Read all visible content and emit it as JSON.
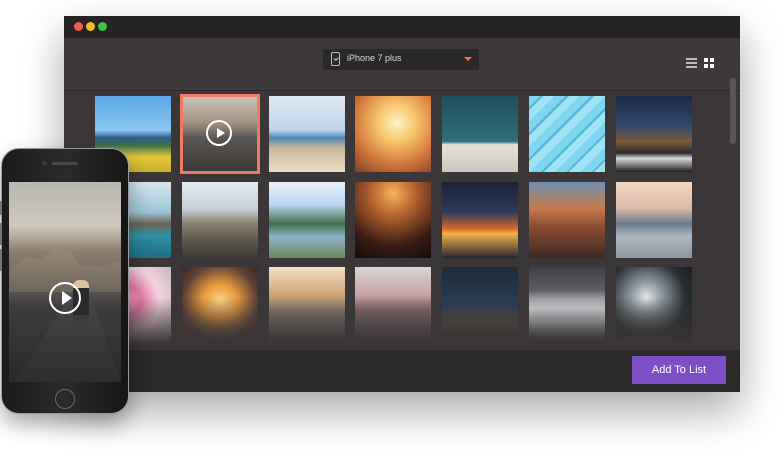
{
  "window": {
    "device_select": {
      "value": "iPhone 7 plus",
      "icon": "iphone-check-icon",
      "caret_color": "#f07a30"
    },
    "view_toggle": {
      "list_icon": "list-view-icon",
      "grid_icon": "grid-view-icon"
    },
    "add_button_label": "Add To List",
    "accent_color": "#7d4fc7",
    "selected_outline_color": "#f07a64"
  },
  "thumbnails": [
    {
      "subject": "coast-landscape",
      "selected": false,
      "video": false
    },
    {
      "subject": "skateboarder-road",
      "selected": true,
      "video": true
    },
    {
      "subject": "beach-skateboard",
      "selected": false,
      "video": false
    },
    {
      "subject": "sunset-runners",
      "selected": false,
      "video": false
    },
    {
      "subject": "bird-on-wall",
      "selected": false,
      "video": false
    },
    {
      "subject": "glass-building",
      "selected": false,
      "video": false
    },
    {
      "subject": "city-car-night",
      "selected": false,
      "video": false
    },
    {
      "subject": "cliff-diver",
      "selected": false,
      "video": false
    },
    {
      "subject": "cathedral-street",
      "selected": false,
      "video": false
    },
    {
      "subject": "lake-person",
      "selected": false,
      "video": false
    },
    {
      "subject": "concert-lights",
      "selected": false,
      "video": false
    },
    {
      "subject": "city-traffic-night",
      "selected": false,
      "video": false
    },
    {
      "subject": "crowd-selfie",
      "selected": false,
      "video": false
    },
    {
      "subject": "beach-dusk",
      "selected": false,
      "video": false
    },
    {
      "subject": "balloons",
      "selected": false,
      "video": false
    },
    {
      "subject": "toast-sunset",
      "selected": false,
      "video": false
    },
    {
      "subject": "street-buildings",
      "selected": false,
      "video": false
    },
    {
      "subject": "mountain-sunset",
      "selected": false,
      "video": false
    },
    {
      "subject": "street-dancer",
      "selected": false,
      "video": false
    },
    {
      "subject": "man-white-shirt",
      "selected": false,
      "video": false
    },
    {
      "subject": "stage-performance",
      "selected": false,
      "video": false
    }
  ],
  "phone": {
    "screen_subject": "skateboarder-road",
    "video": true
  }
}
